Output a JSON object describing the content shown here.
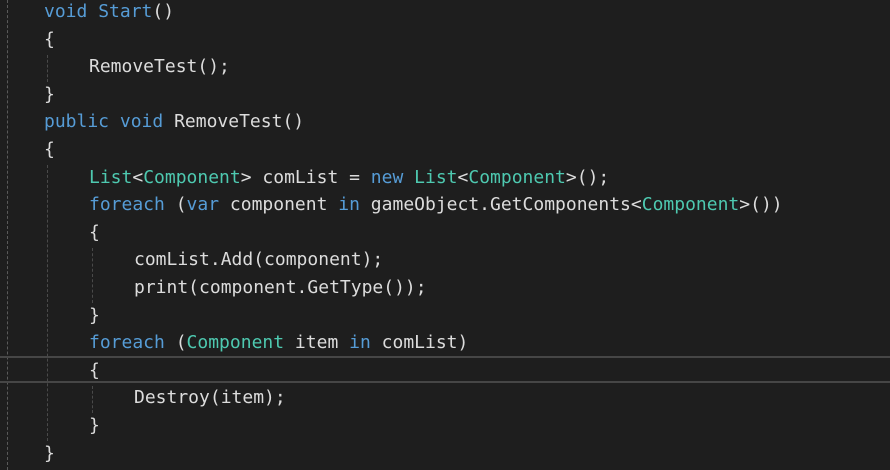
{
  "code_lines": [
    [
      {
        "t": "void",
        "k": "kw"
      },
      {
        "t": " ",
        "k": "pl"
      },
      {
        "t": "Start",
        "k": "kw"
      },
      {
        "t": "()",
        "k": "pl"
      }
    ],
    [
      {
        "t": "{",
        "k": "pl"
      }
    ],
    [
      {
        "t": "RemoveTest();",
        "k": "pl"
      }
    ],
    [
      {
        "t": "}",
        "k": "pl"
      }
    ],
    [
      {
        "t": "public",
        "k": "kw"
      },
      {
        "t": " ",
        "k": "pl"
      },
      {
        "t": "void",
        "k": "kw"
      },
      {
        "t": " RemoveTest()",
        "k": "pl"
      }
    ],
    [
      {
        "t": "{",
        "k": "pl"
      }
    ],
    [
      {
        "t": "List",
        "k": "ty"
      },
      {
        "t": "<",
        "k": "pl"
      },
      {
        "t": "Component",
        "k": "ty"
      },
      {
        "t": "> comList = ",
        "k": "pl"
      },
      {
        "t": "new",
        "k": "kw"
      },
      {
        "t": " ",
        "k": "pl"
      },
      {
        "t": "List",
        "k": "ty"
      },
      {
        "t": "<",
        "k": "pl"
      },
      {
        "t": "Component",
        "k": "ty"
      },
      {
        "t": ">();",
        "k": "pl"
      }
    ],
    [
      {
        "t": "foreach",
        "k": "kw"
      },
      {
        "t": " (",
        "k": "pl"
      },
      {
        "t": "var",
        "k": "kw"
      },
      {
        "t": " component ",
        "k": "pl"
      },
      {
        "t": "in",
        "k": "kw"
      },
      {
        "t": " gameObject.GetComponents<",
        "k": "pl"
      },
      {
        "t": "Component",
        "k": "ty"
      },
      {
        "t": ">())",
        "k": "pl"
      }
    ],
    [
      {
        "t": "{",
        "k": "pl"
      }
    ],
    [
      {
        "t": "comList.Add(component);",
        "k": "pl"
      }
    ],
    [
      {
        "t": "print(component.GetType());",
        "k": "pl"
      }
    ],
    [
      {
        "t": "}",
        "k": "pl"
      }
    ],
    [
      {
        "t": "foreach",
        "k": "kw"
      },
      {
        "t": " (",
        "k": "pl"
      },
      {
        "t": "Component",
        "k": "ty"
      },
      {
        "t": " item ",
        "k": "pl"
      },
      {
        "t": "in",
        "k": "kw"
      },
      {
        "t": " comList)",
        "k": "pl"
      }
    ],
    [
      {
        "t": "{",
        "k": "pl"
      }
    ],
    [
      {
        "t": "Destroy(item);",
        "k": "pl"
      }
    ],
    [
      {
        "t": "}",
        "k": "pl"
      }
    ],
    [
      {
        "t": "}",
        "k": "pl"
      }
    ]
  ],
  "colors": {
    "background": "#1e1e1e",
    "keyword": "#569cd6",
    "type": "#4ec9b0",
    "plain": "#dcdcdc"
  }
}
